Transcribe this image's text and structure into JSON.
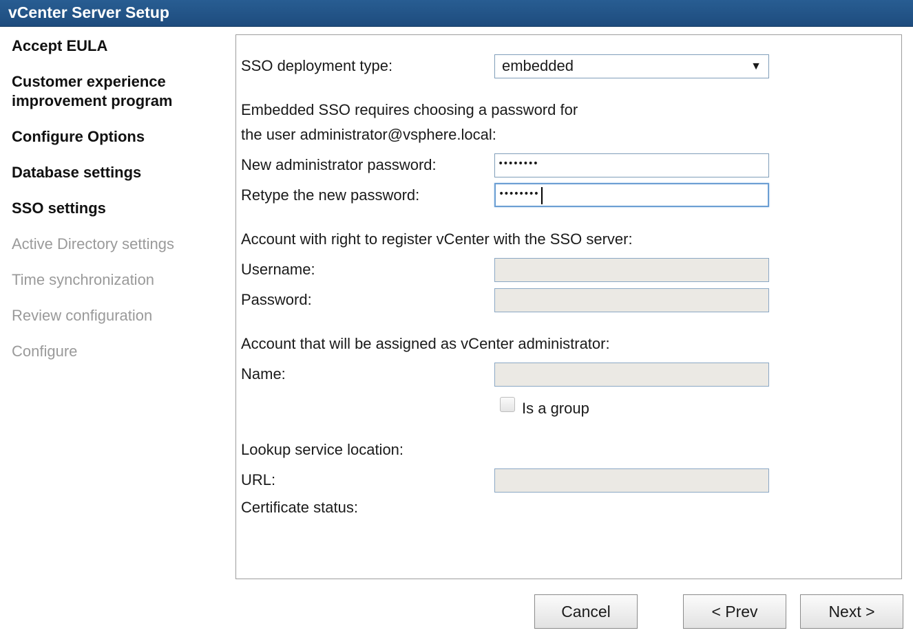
{
  "window": {
    "title": "vCenter Server Setup"
  },
  "sidebar": {
    "items": [
      {
        "label": "Accept EULA"
      },
      {
        "label": "Customer experience"
      },
      {
        "label": "improvement program"
      },
      {
        "label": "Configure Options"
      },
      {
        "label": "Database settings"
      },
      {
        "label": "SSO settings"
      },
      {
        "label": "Active Directory settings"
      },
      {
        "label": "Time synchronization"
      },
      {
        "label": "Review configuration"
      },
      {
        "label": "Configure"
      }
    ]
  },
  "form": {
    "sso_type_label": "SSO deployment type:",
    "sso_type_value": "embedded",
    "embedded_note_line1": "Embedded SSO requires choosing a password for",
    "embedded_note_line2": "the user administrator@vsphere.local:",
    "new_password_label": "New administrator password:",
    "new_password_value": "••••••••",
    "retype_password_label": "Retype the new password:",
    "retype_password_value": "••••••••",
    "register_account_heading": "Account with right to register vCenter with the SSO server:",
    "username_label": "Username:",
    "username_value": "",
    "password_label": "Password:",
    "password_value": "",
    "admin_account_heading": "Account that will be assigned as vCenter administrator:",
    "name_label": "Name:",
    "name_value": "",
    "is_group_label": "Is a group",
    "is_group_checked": false,
    "lookup_heading": "Lookup service location:",
    "url_label": "URL:",
    "url_value": "",
    "cert_status_label": "Certificate status:"
  },
  "buttons": {
    "cancel": "Cancel",
    "prev": "< Prev",
    "next": "Next >"
  }
}
